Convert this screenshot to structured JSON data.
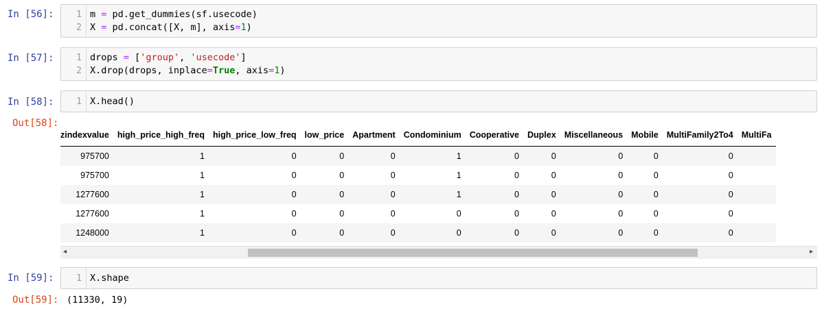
{
  "cells": [
    {
      "in_label": "In  [56]:",
      "lines": [
        [
          "m ",
          "=",
          " pd.get_dummies(sf.usecode)"
        ],
        [
          "X ",
          "=",
          " pd.concat([X, m], axis",
          "=",
          "1",
          ")"
        ]
      ]
    },
    {
      "in_label": "In  [57]:"
    },
    {
      "in_label": "In  [58]:",
      "out_label": "Out[58]:"
    },
    {
      "in_label": "In  [59]:",
      "out_label": "Out[59]:",
      "output": "(11330, 19)"
    }
  ],
  "code": {
    "c56_l1_a": "m ",
    "c56_l1_op": "=",
    "c56_l1_b": " pd.get_dummies(sf.usecode)",
    "c56_l2_a": "X ",
    "c56_l2_op": "=",
    "c56_l2_b": " pd.concat([X, m], axis",
    "c56_l2_op2": "=",
    "c56_l2_num": "1",
    "c56_l2_c": ")",
    "c57_l1_a": "drops ",
    "c57_l1_op": "=",
    "c57_l1_b": " [",
    "c57_l1_s1": "'group'",
    "c57_l1_c": ", ",
    "c57_l1_s2": "'usecode'",
    "c57_l1_d": "]",
    "c57_l2_a": "X.drop(drops, inplace",
    "c57_l2_op": "=",
    "c57_l2_kw": "True",
    "c57_l2_b": ", axis",
    "c57_l2_op2": "=",
    "c57_l2_num": "1",
    "c57_l2_c": ")",
    "c58_l1": "X.head()",
    "c59_l1": "X.shape"
  },
  "line_numbers": {
    "one": "1",
    "two": "2"
  },
  "table": {
    "columns": [
      "zindexvalue",
      "high_price_high_freq",
      "high_price_low_freq",
      "low_price",
      "Apartment",
      "Condominium",
      "Cooperative",
      "Duplex",
      "Miscellaneous",
      "Mobile",
      "MultiFamily2To4",
      "MultiFa"
    ],
    "rows": [
      [
        "975700",
        "1",
        "0",
        "0",
        "0",
        "1",
        "0",
        "0",
        "0",
        "0",
        "0",
        ""
      ],
      [
        "975700",
        "1",
        "0",
        "0",
        "0",
        "1",
        "0",
        "0",
        "0",
        "0",
        "0",
        ""
      ],
      [
        "1277600",
        "1",
        "0",
        "0",
        "0",
        "1",
        "0",
        "0",
        "0",
        "0",
        "0",
        ""
      ],
      [
        "1277600",
        "1",
        "0",
        "0",
        "0",
        "0",
        "0",
        "0",
        "0",
        "0",
        "0",
        ""
      ],
      [
        "1248000",
        "1",
        "0",
        "0",
        "0",
        "0",
        "0",
        "0",
        "0",
        "0",
        "0",
        ""
      ]
    ]
  },
  "scrollbar": {
    "left_arrow": "◂",
    "right_arrow": "▸"
  }
}
